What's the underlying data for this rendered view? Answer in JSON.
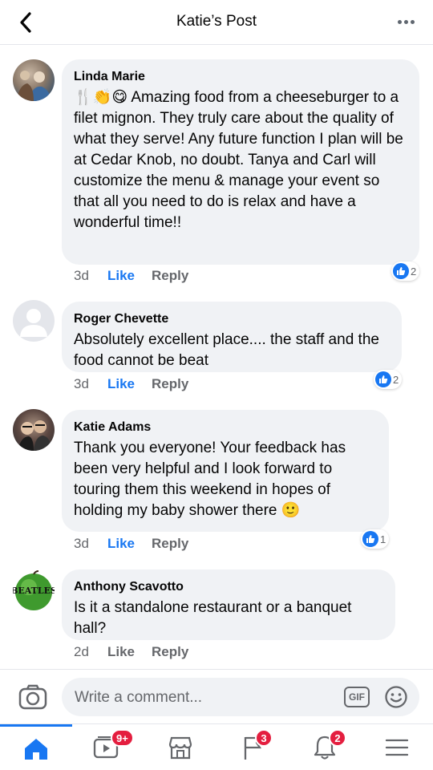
{
  "header": {
    "title": "Katie’s Post"
  },
  "comments": [
    {
      "author": "Linda Marie",
      "text_emoji": "🍴👏😋",
      "text": "Amazing food from a cheeseburger to a filet mignon. They truly care about the quality of what they serve! Any future function I plan will be at Cedar Knob, no doubt. Tanya and Carl will customize the menu & manage your event so that all you need to do is relax and have a wonderful time!!",
      "time": "3d",
      "like_label": "Like",
      "reply_label": "Reply",
      "reaction_count": "2"
    },
    {
      "author": "Roger Chevette",
      "text": "Absolutely excellent place.... the staff and the food cannot be beat",
      "time": "3d",
      "like_label": "Like",
      "reply_label": "Reply",
      "reaction_count": "2"
    },
    {
      "author": "Katie Adams",
      "text": "Thank you everyone! Your feedback has been very helpful and I look forward to touring them this weekend in hopes of holding my baby shower there",
      "text_emoji": "🙂",
      "time": "3d",
      "like_label": "Like",
      "reply_label": "Reply",
      "reaction_count": "1"
    },
    {
      "author": "Anthony Scavotto",
      "text": "Is it a standalone restaurant or a banquet hall?",
      "time": "2d",
      "like_label": "Like",
      "reply_label": "Reply",
      "avatar_text": "BEATLES"
    }
  ],
  "composer": {
    "placeholder": "Write a comment...",
    "gif_label": "GIF"
  },
  "bottom_nav": {
    "items": [
      {
        "icon": "home-icon",
        "active": true
      },
      {
        "icon": "watch-icon",
        "badge": "9+"
      },
      {
        "icon": "marketplace-icon"
      },
      {
        "icon": "flag-icon",
        "badge": "3"
      },
      {
        "icon": "bell-icon",
        "badge": "2"
      },
      {
        "icon": "menu-icon"
      }
    ]
  },
  "colors": {
    "accent": "#1877f2",
    "bubble": "#f0f2f5",
    "badge": "#e41e3f",
    "secondary_text": "#65676b"
  }
}
